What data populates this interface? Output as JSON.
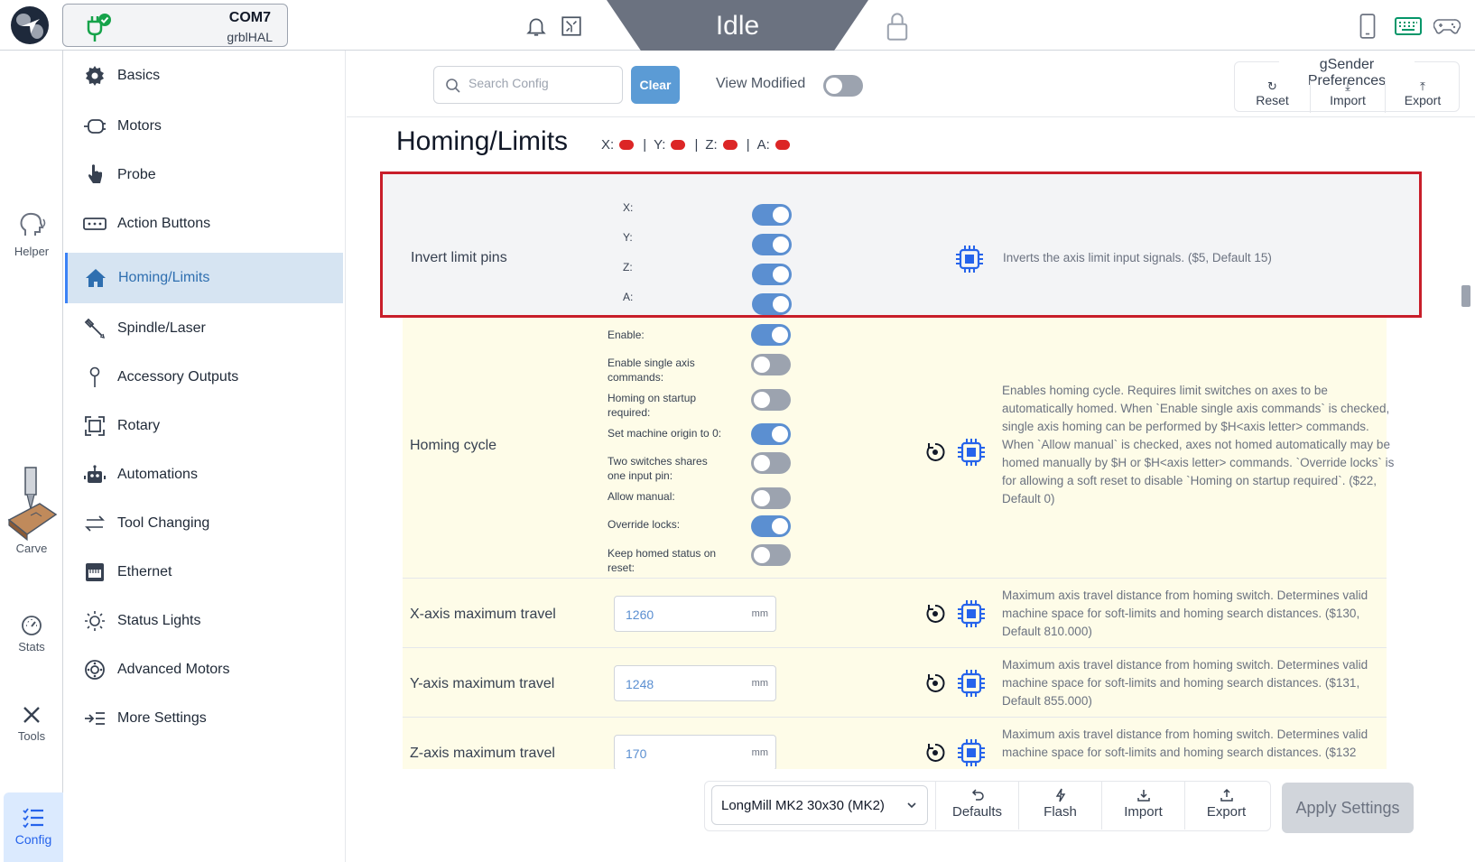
{
  "connection": {
    "port": "COM7",
    "firmware": "grblHAL"
  },
  "machine_state": "Idle",
  "rail": {
    "helper": "Helper",
    "carve": "Carve",
    "stats": "Stats",
    "tools": "Tools",
    "config": "Config"
  },
  "nav": {
    "items": [
      "Basics",
      "Motors",
      "Probe",
      "Action Buttons",
      "Homing/Limits",
      "Spindle/Laser",
      "Accessory Outputs",
      "Rotary",
      "Automations",
      "Tool Changing",
      "Ethernet",
      "Status Lights",
      "Advanced Motors",
      "More Settings"
    ],
    "active": "Homing/Limits"
  },
  "toolbar": {
    "search_placeholder": "Search Config",
    "clear_label": "Clear",
    "view_modified": "View Modified",
    "prefs_title": "gSender Preferences",
    "prefs_reset": "Reset",
    "prefs_import": "Import",
    "prefs_export": "Export"
  },
  "section": {
    "title": "Homing/Limits",
    "axes": [
      "X:",
      "Y:",
      "Z:",
      "A:"
    ],
    "separator": "|"
  },
  "invert_limit": {
    "label": "Invert limit pins",
    "axes": [
      "X:",
      "Y:",
      "Z:",
      "A:"
    ],
    "axes_on": [
      true,
      true,
      true,
      true
    ],
    "desc": "Inverts the axis limit input signals. ($5, Default 15)"
  },
  "homing_cycle": {
    "label": "Homing cycle",
    "options": [
      {
        "label": "Enable:",
        "on": true
      },
      {
        "label": "Enable single axis commands:",
        "on": false
      },
      {
        "label": "Homing on startup required:",
        "on": false
      },
      {
        "label": "Set machine origin to 0:",
        "on": true
      },
      {
        "label": "Two switches shares one input pin:",
        "on": false
      },
      {
        "label": "Allow manual:",
        "on": false
      },
      {
        "label": "Override locks:",
        "on": true
      },
      {
        "label": "Keep homed status on reset:",
        "on": false
      }
    ],
    "desc": "Enables homing cycle. Requires limit switches on axes to be automatically homed. When `Enable single axis commands` is checked, single axis homing can be performed by $H<axis letter> commands. When `Allow manual` is checked, axes not homed automatically may be homed manually by $H or $H<axis letter> commands. `Override locks` is for allowing a soft reset to disable `Homing on startup required`. ($22, Default 0)"
  },
  "travel": {
    "unit": "mm",
    "x": {
      "label": "X-axis maximum travel",
      "value": "1260",
      "desc": "Maximum axis travel distance from homing switch. Determines valid machine space for soft-limits and homing search distances. ($130, Default 810.000)"
    },
    "y": {
      "label": "Y-axis maximum travel",
      "value": "1248",
      "desc": "Maximum axis travel distance from homing switch. Determines valid machine space for soft-limits and homing search distances. ($131, Default 855.000)"
    },
    "z": {
      "label": "Z-axis maximum travel",
      "value": "170",
      "desc": "Maximum axis travel distance from homing switch. Determines valid machine space for soft-limits and homing search distances. ($132"
    }
  },
  "bottom": {
    "profile": "LongMill MK2 30x30 (MK2)",
    "defaults": "Defaults",
    "flash": "Flash",
    "import": "Import",
    "export": "Export",
    "apply": "Apply Settings"
  },
  "colors": {
    "accent": "#5b9bd5",
    "toggle_on": "#5b8fd1",
    "active_nav_bg": "#d6e4f2",
    "highlight_border": "#c81e2a",
    "yellow_row": "#fefce8",
    "limit_dot": "#dc2626"
  },
  "icons": {
    "top": [
      "bell-icon",
      "circuit-board-icon",
      "lock-icon",
      "phone-icon",
      "keyboard-icon",
      "gamepad-icon"
    ],
    "nav": [
      "gear-icon",
      "motor-icon",
      "probe-hand-icon",
      "buttons-icon",
      "home-icon",
      "spindle-icon",
      "pin-icon",
      "rotary-icon",
      "robot-icon",
      "swap-arrows-icon",
      "ethernet-icon",
      "sun-icon",
      "motor-circle-icon",
      "list-arrow-icon"
    ]
  }
}
